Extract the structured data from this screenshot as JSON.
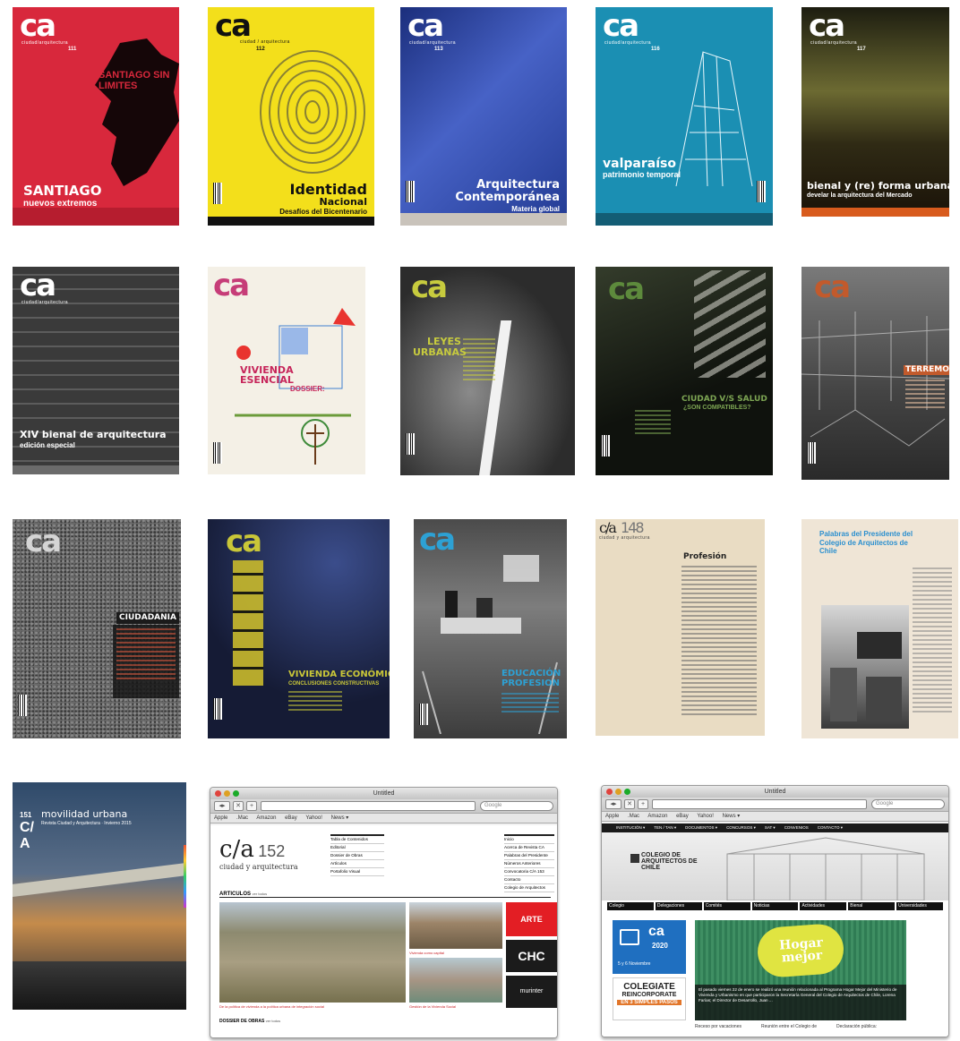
{
  "covers": {
    "c111": {
      "logo": "ca",
      "sublogo": "ciudad/arquitectura",
      "number": "111",
      "tagline": "SANTIAGO SIN LIMITES",
      "title": "SANTIAGO",
      "subtitle": "nuevos extremos",
      "color": "#d8283c"
    },
    "c112": {
      "logo": "ca",
      "sublogo": "ciudad / arquitectura",
      "number": "112",
      "title": "Identidad",
      "title2": "Nacional",
      "subtitle": "Desafíos del Bicentenario",
      "color": "#f3df1b"
    },
    "c113": {
      "logo": "ca",
      "sublogo": "ciudad/arquitectura",
      "number": "113",
      "title": "Arquitectura",
      "title2": "Contemporánea",
      "subtitle": "Materia global",
      "color": "#2a46a3"
    },
    "c116": {
      "logo": "ca",
      "sublogo": "ciudad/arquitectura",
      "number": "116",
      "title": "valparaíso",
      "subtitle": "patrimonio temporal",
      "color": "#1b8fb3"
    },
    "c117": {
      "logo": "ca",
      "sublogo": "ciudad/arquitectura",
      "number": "117",
      "title": "bienal y (re) forma urbana",
      "subtitle": "develar la arquitectura del Mercado",
      "color": "#4e4a24"
    },
    "c118": {
      "logo": "ca",
      "sublogo": "ciudad/arquitectura",
      "title": "XIV bienal de arquitectura",
      "subtitle": "edición especial",
      "color": "#4b4b4b"
    },
    "c119": {
      "logo": "ca",
      "title": "VIVIENDA",
      "title2": "ESENCIAL",
      "subtitle": "DOSSIER:",
      "color": "#f4f0e6"
    },
    "c120": {
      "logo": "ca",
      "title": "LEYES",
      "title2": "URBANAS",
      "color": "#3a3a3a"
    },
    "c121": {
      "logo": "ca",
      "title": "CIUDAD V/S SALUD",
      "subtitle": "¿SON COMPATIBLES?",
      "color": "#1e2219"
    },
    "c122": {
      "logo": "ca",
      "title": "TERREMOTOS",
      "color": "#5a5a5a"
    },
    "c123": {
      "logo": "ca",
      "title": "CIUDADANIA",
      "color": "#6a6a6a"
    },
    "c124": {
      "logo": "ca",
      "title": "VIVIENDA ECONÓMICA",
      "subtitle": "CONCLUSIONES CONSTRUCTIVAS",
      "color": "#18203e"
    },
    "c125": {
      "logo": "ca",
      "title": "EDUCACIÓN",
      "title2": "PROFESION",
      "color": "#565656"
    },
    "c148": {
      "logo": "c/a",
      "number": "148",
      "sublogo": "ciudad y arquitectura",
      "title": "Profesión",
      "color": "#e9dcc3"
    },
    "c149": {
      "title": "Palabras del Presidente del Colegio de Arquitectos de Chile",
      "color": "#efe5d6"
    },
    "c151": {
      "number": "151",
      "logo": "C/A",
      "title": "movilidad urbana",
      "subtitle": "Revista Ciudad y Arquitectura · Invierno 2015",
      "color": "#2d3e58"
    }
  },
  "browser1": {
    "title": "Untitled",
    "search_placeholder": "Google",
    "bookmarks": [
      "Apple",
      ".Mac",
      "Amazon",
      "eBay",
      "Yahoo!",
      "News ▾"
    ],
    "logo": "c/a",
    "logo_number": "152",
    "logo_sub": "ciudad y arquitectura",
    "menu_left": [
      "Tabla de Contenidos",
      "Editorial",
      "Dossier de Obras",
      "Artículos",
      "Portafolio Visual"
    ],
    "menu_right": [
      "Inicio",
      "Acerca de Revista CA",
      "Palabras del Presidente",
      "Números Anteriores",
      "Convocatoria C/A 153",
      "Contacto",
      "Colegio de Arquitectos"
    ],
    "section_articles": "ARTICULOS",
    "section_articles_more": "ver todos",
    "article1_caption": "De la política de vivienda a la política urbana de integración social",
    "article2_caption": "Vivienda como capital",
    "article3_caption": "Gestión de la Vivienda Social",
    "ads": [
      "ARTE NOSTRA",
      "CHC",
      "murinter DECOSTORE"
    ],
    "section_dossier": "DOSSIER DE OBRAS",
    "section_dossier_more": "ver todos"
  },
  "browser2": {
    "title": "Untitled",
    "search_placeholder": "Google",
    "bookmarks": [
      "Apple",
      ".Mac",
      "Amazon",
      "eBay",
      "Yahoo!",
      "News ▾"
    ],
    "nav": [
      "INSTITUCIÓN ▾",
      "TEN / TAN ▾",
      "DOCUMENTOS ▾",
      "CONCURSOS ▾",
      "SAT ▾",
      "CONVENIOS",
      "CONTACTO ▾"
    ],
    "org_name": "COLEGIO DE ARQUITECTOS DE CHILE",
    "tabs": [
      "Colegio",
      "Delegaciones",
      "Comités",
      "Noticias",
      "Actividades",
      "Bienal",
      "Universidades"
    ],
    "promo1_logo": "ca",
    "promo1_sub": "2020",
    "promo1_text": "5 y 6 Noviembre",
    "promo2_title": "COLEGIATE",
    "promo2_sub": "REINCORPORATE",
    "promo2_steps": "EN 3 SIMPLES PASOS",
    "hero_badge": "Hogar mejor",
    "hero_text": "El pasado viernes 22 de enero se realizó una reunión relacionada al Programa Hogar Mejor del Ministerio de Vivienda y Urbanismo en que participaron la Secretaría General del Colegio de Arquitectos de Chile, Lorena Farías; el Director de Desarrollo, Juan ...",
    "bottom_items": [
      "Receso por vacaciones",
      "Reunión entre el Colegio de",
      "Declaración pública:"
    ]
  }
}
